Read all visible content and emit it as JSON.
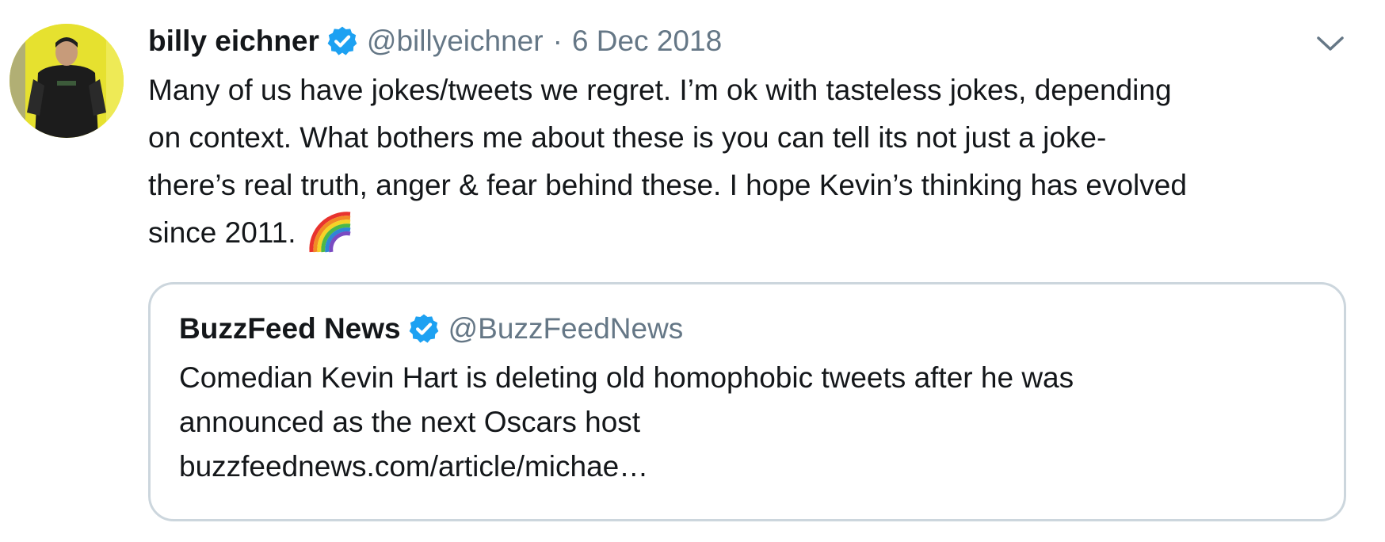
{
  "tweet": {
    "author_name": "billy eichner",
    "handle": "@billyeichner",
    "separator": "·",
    "date": "6 Dec 2018",
    "lines": [
      "Many of us have jokes/tweets we regret. I’m ok with tasteless jokes, depending",
      "on context. What bothers me about these is you can tell its not just a joke-",
      "there’s real truth, anger & fear behind these. I hope Kevin’s thinking has evolved",
      "since 2011."
    ],
    "emoji": "rainbow"
  },
  "quoted_tweet": {
    "author_name": "BuzzFeed News",
    "handle": "@BuzzFeedNews",
    "lines": [
      "Comedian Kevin Hart is deleting old homophobic tweets after he was",
      "announced as the next Oscars host",
      "buzzfeednews.com/article/michae…"
    ]
  },
  "icons": {
    "verified": "verified-badge-icon",
    "menu": "chevron-down-icon",
    "emoji": "rainbow-emoji-icon"
  },
  "colors": {
    "verified_blue": "#1da1f2",
    "secondary_text": "#657786",
    "border": "#ccd6dd",
    "avatar_background": "#e6e12f"
  }
}
